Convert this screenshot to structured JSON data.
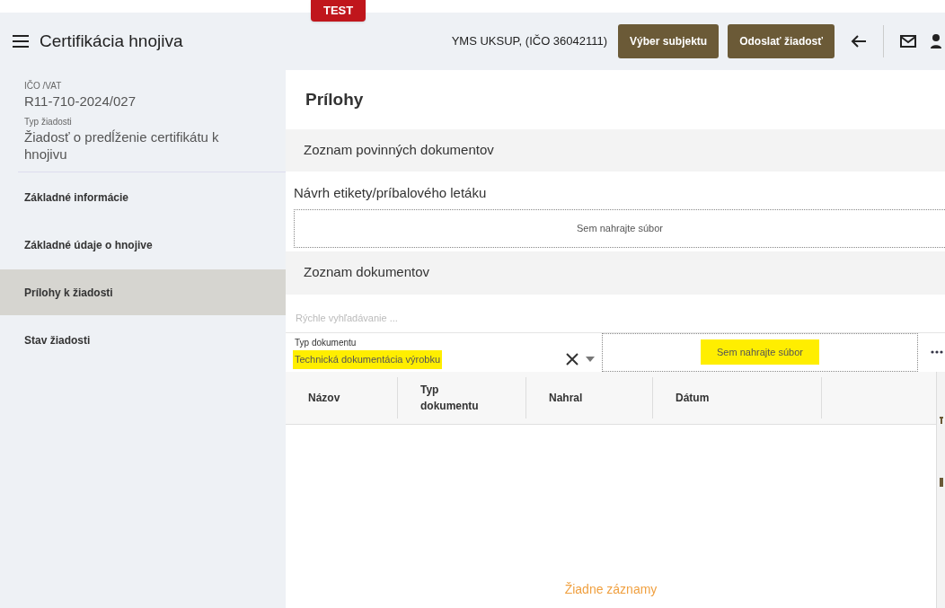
{
  "header": {
    "title": "Certifikácia hnojiva",
    "env_badge": "TEST",
    "subject": "YMS UKSUP, (IČO 36042111)",
    "buttons": [
      "Výber subjektu",
      "Odoslať žiadosť"
    ]
  },
  "sidebar": {
    "info": [
      {
        "label": "IČO /VAT",
        "value": "R11-710-2024/027"
      },
      {
        "label": "Typ žiadosti",
        "value": "Žiadosť o predĺženie certifikátu k hnojivu"
      }
    ],
    "items": [
      {
        "label": "Základné informácie",
        "selected": false
      },
      {
        "label": "Základné údaje o hnojive",
        "selected": false
      },
      {
        "label": "Prílohy k žiadosti",
        "selected": true
      },
      {
        "label": "Stav žiadosti",
        "selected": false
      }
    ]
  },
  "main": {
    "title": "Prílohy",
    "required_section": {
      "title": "Zoznam povinných dokumentov",
      "document": "Návrh etikety/príbalového letáku",
      "upload": "Sem nahrajte súbor"
    },
    "documents_section": {
      "title": "Zoznam dokumentov",
      "search": {
        "placeholder": "Rýchle vyhľadávanie ..."
      },
      "type_field": {
        "label": "Typ dokumentu",
        "value": "Technická dokumentácia výrobku",
        "highlighted": true
      },
      "upload": {
        "text": "Sem nahrajte súbor",
        "highlighted": true
      },
      "table": {
        "columns": [
          "Názov",
          "Typ dokumentu",
          "Nahral",
          "Dátum"
        ],
        "empty": "Žiadne záznamy"
      }
    }
  }
}
